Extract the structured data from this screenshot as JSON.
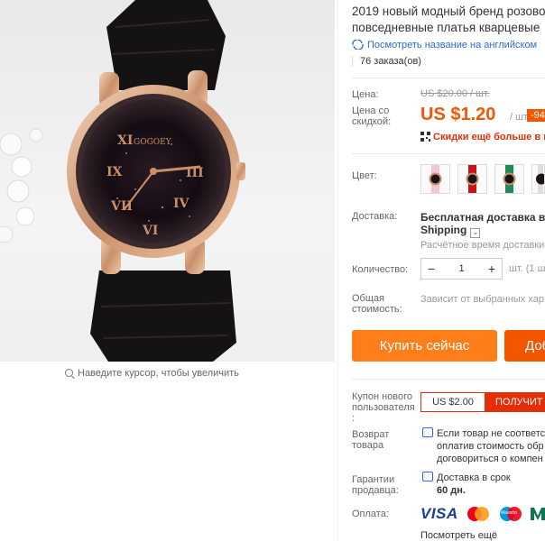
{
  "product": {
    "title_line1": "2019 новый модный бренд розово",
    "title_line2": "повседневные платья кварцевые",
    "translate_link": "Посмотреть название на английском",
    "orders": "76 заказа(ов)"
  },
  "gallery": {
    "zoom_hint": "Наведите курсор, чтобы увеличить",
    "watch_brand": "GOGOEY"
  },
  "price": {
    "label": "Цена:",
    "old": "US $20.00 / шт.",
    "discount_label": "Цена со скидкой:",
    "current": "US $1.20",
    "per_unit": "/ шт.",
    "discount_badge": "-94",
    "promo": "Скидки ещё больше в п"
  },
  "color": {
    "label": "Цвет:",
    "swatches": [
      "pink-white",
      "red",
      "green",
      "black-white"
    ]
  },
  "shipping": {
    "label": "Доставка:",
    "title_line1": "Бесплатная доставка в Ru",
    "title_line2": "Shipping",
    "estimate": "Расчётное время доставки"
  },
  "quantity": {
    "label": "Количество:",
    "value": "1",
    "minus": "−",
    "plus": "+",
    "unit_note": "шт. (1 ш"
  },
  "total": {
    "label_line1": "Общая",
    "label_line2": "стоимость:",
    "note": "Зависит от выбранных хар"
  },
  "actions": {
    "buy_now": "Купить сейчас",
    "add_to_cart": "Доб"
  },
  "coupon": {
    "label_line1": "Купон нового",
    "label_line2": "пользователя",
    "label_line3": ":",
    "amount": "US $2.00",
    "get": "ПОЛУЧИТ"
  },
  "returns": {
    "label_line1": "Возврат",
    "label_line2": "товара",
    "text_line1": "Если товар не соответст",
    "text_line2": "оплатив стоимость обр",
    "text_line3": "договориться о компен"
  },
  "guarantee": {
    "label_line1": "Гарантии",
    "label_line2": "продавца:",
    "text_line1": "Доставка в срок",
    "text_line2": "60 дн."
  },
  "payment": {
    "label": "Оплата:",
    "visa": "VISA",
    "maestro": "Maestro",
    "more_link": "Посмотреть ещё"
  },
  "colors": {
    "accent_orange": "#ff7e1a",
    "price_orange": "#f45600",
    "promo_red": "#e62e04",
    "link_blue": "#2b6ad6"
  }
}
